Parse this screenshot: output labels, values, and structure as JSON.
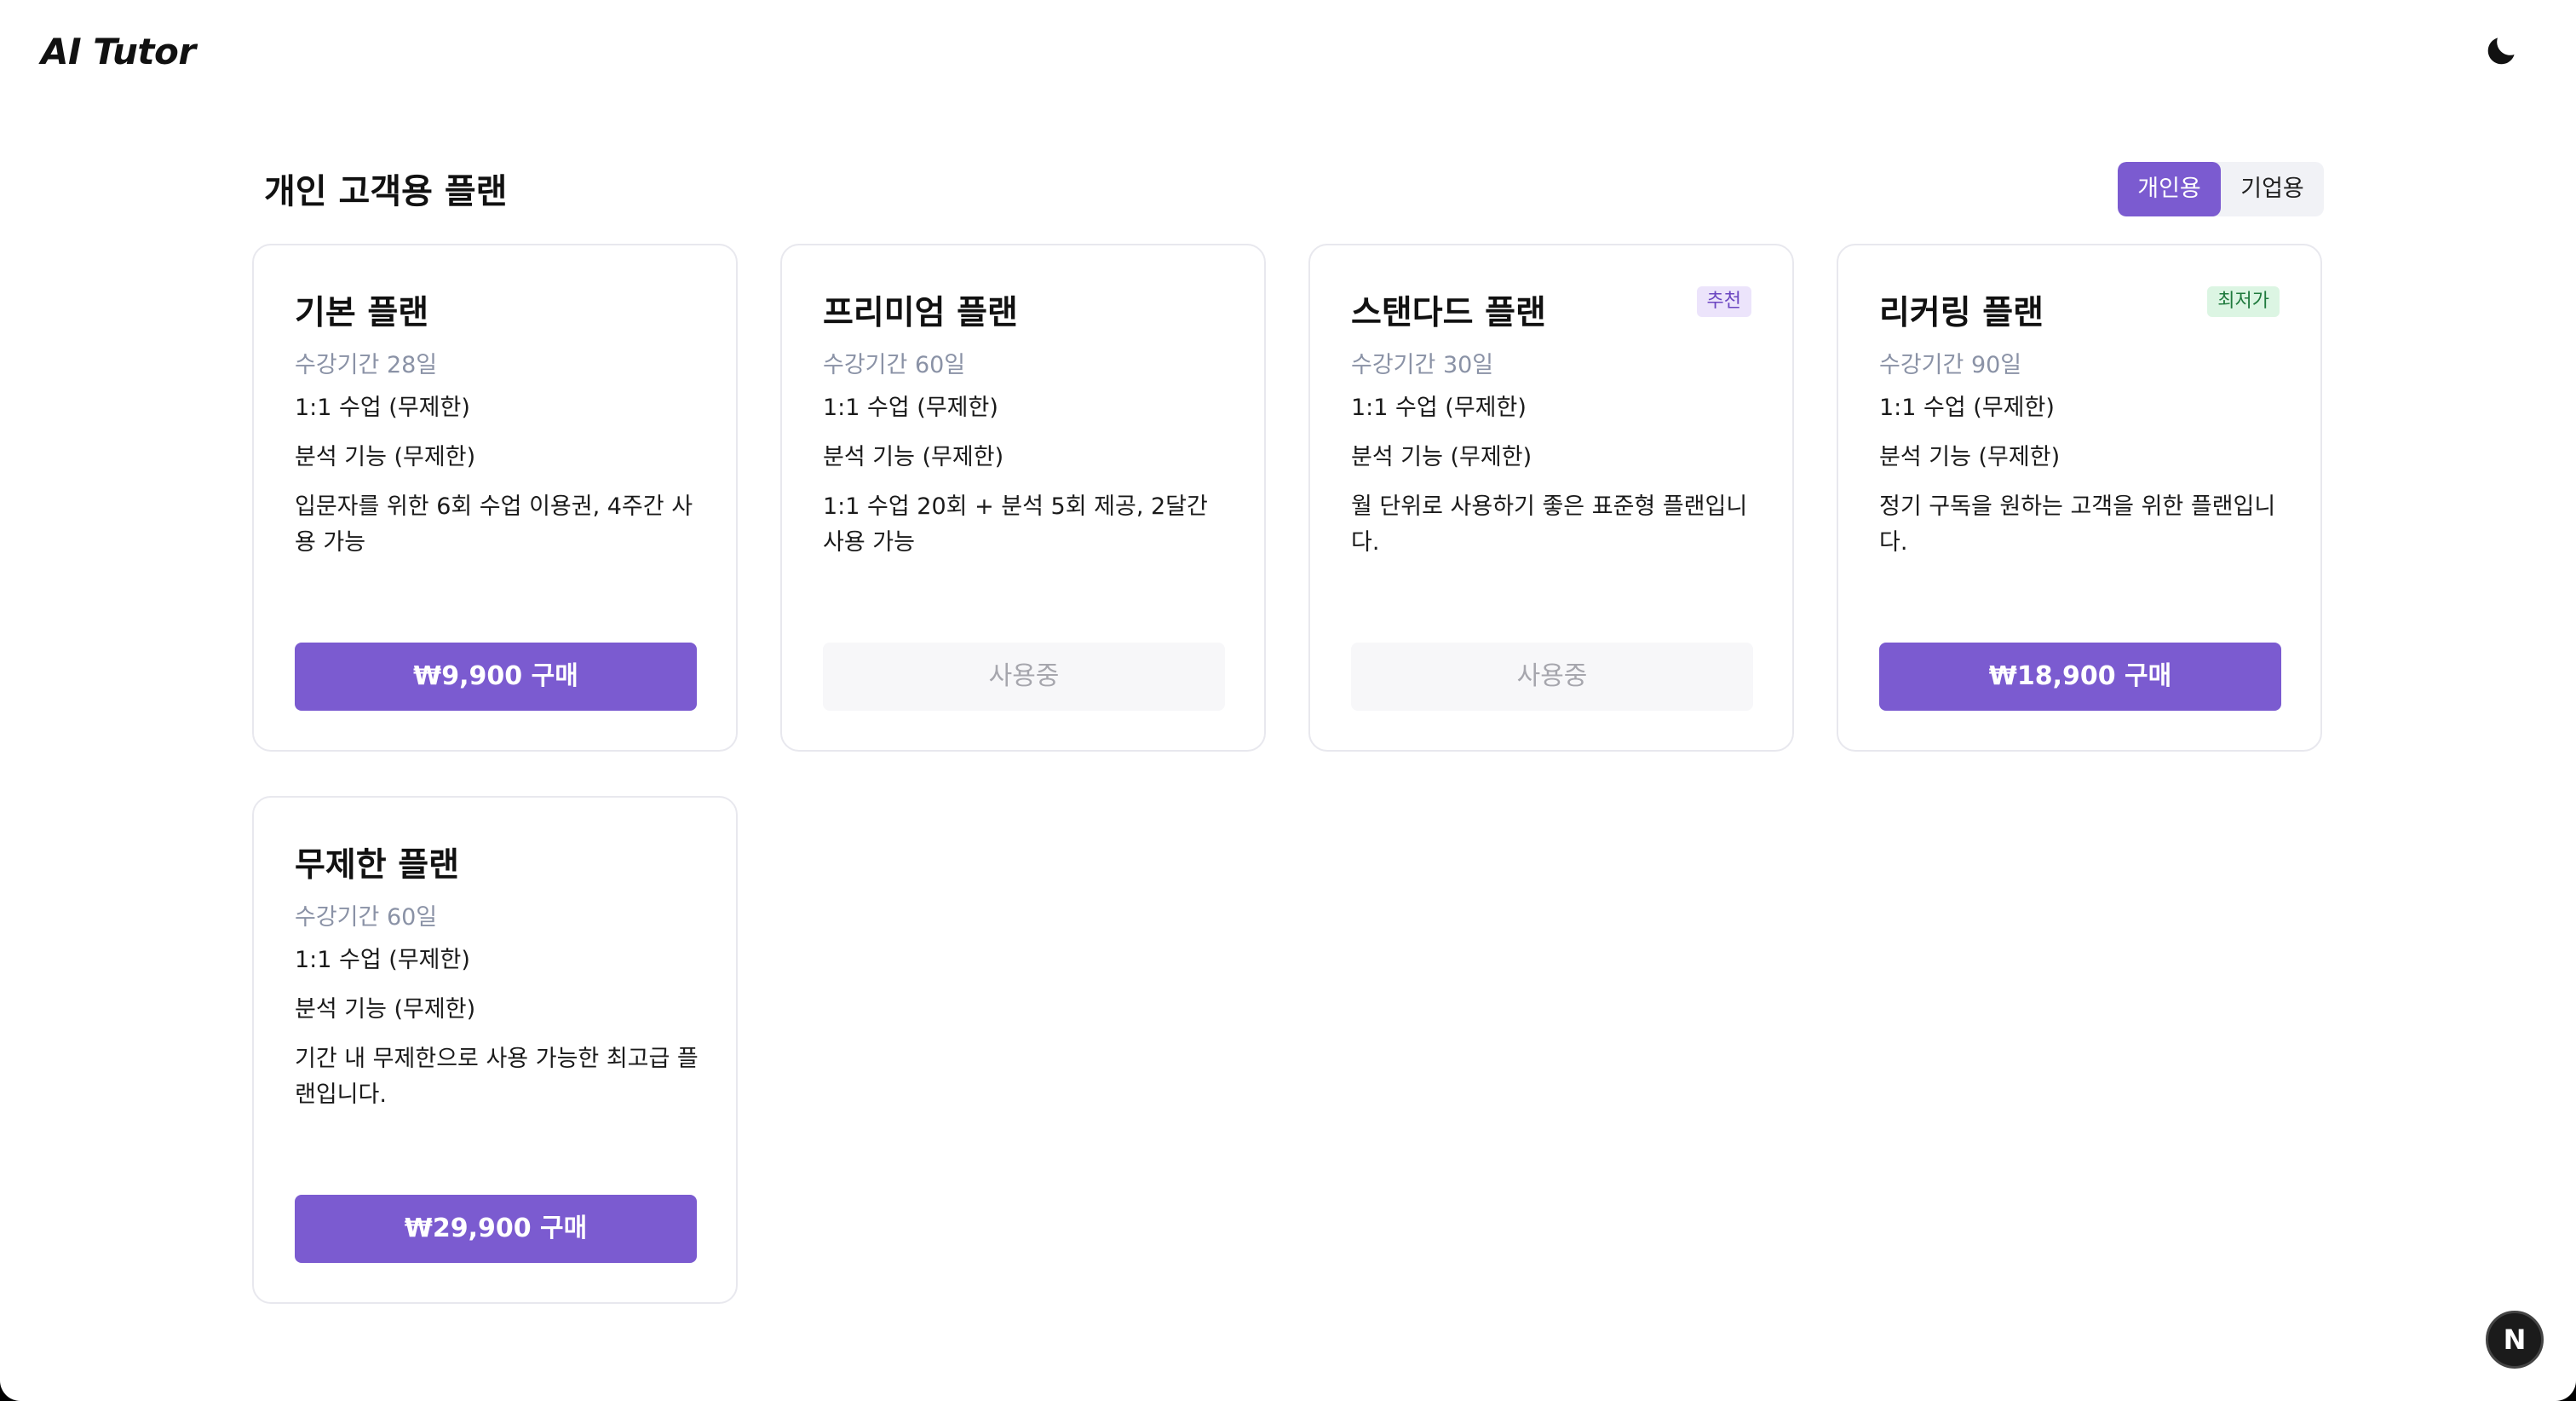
{
  "app": {
    "brand": "AI Tutor"
  },
  "header": {
    "theme_icon": "moon-icon"
  },
  "section": {
    "title": "개인 고객용 플랜",
    "tabs": [
      {
        "label": "개인용",
        "active": true
      },
      {
        "label": "기업용",
        "active": false
      }
    ]
  },
  "plans": [
    {
      "title": "기본 플랜",
      "badge": "",
      "duration": "수강기간 28일",
      "features": [
        "1:1 수업 (무제한)",
        "분석 기능 (무제한)",
        "입문자를 위한 6회 수업 이용권, 4주간 사용 가능"
      ],
      "button": "₩9,900 구매",
      "button_state": "buy"
    },
    {
      "title": "프리미엄 플랜",
      "badge": "",
      "duration": "수강기간 60일",
      "features": [
        "1:1 수업 (무제한)",
        "분석 기능 (무제한)",
        "1:1 수업 20회 + 분석 5회 제공, 2달간 사용 가능"
      ],
      "button": "사용중",
      "button_state": "in-use"
    },
    {
      "title": "스탠다드 플랜",
      "badge": "추천",
      "duration": "수강기간 30일",
      "features": [
        "1:1 수업 (무제한)",
        "분석 기능 (무제한)",
        "월 단위로 사용하기 좋은 표준형 플랜입니다."
      ],
      "button": "사용중",
      "button_state": "in-use"
    },
    {
      "title": "리커링 플랜",
      "badge": "최저가",
      "duration": "수강기간 90일",
      "features": [
        "1:1 수업 (무제한)",
        "분석 기능 (무제한)",
        "정기 구독을 원하는 고객을 위한 플랜입니다."
      ],
      "button": "₩18,900 구매",
      "button_state": "buy"
    },
    {
      "title": "무제한 플랜",
      "badge": "",
      "duration": "수강기간 60일",
      "features": [
        "1:1 수업 (무제한)",
        "분석 기능 (무제한)",
        "기간 내 무제한으로 사용 가능한 최고급 플랜입니다."
      ],
      "button": "₩29,900 구매",
      "button_state": "buy"
    }
  ],
  "dev_badge": {
    "label": "N"
  },
  "colors": {
    "accent": "#7b5bd0",
    "badge_recommended_bg": "#ece4fb",
    "badge_lowest_bg": "#dcf5e3"
  }
}
